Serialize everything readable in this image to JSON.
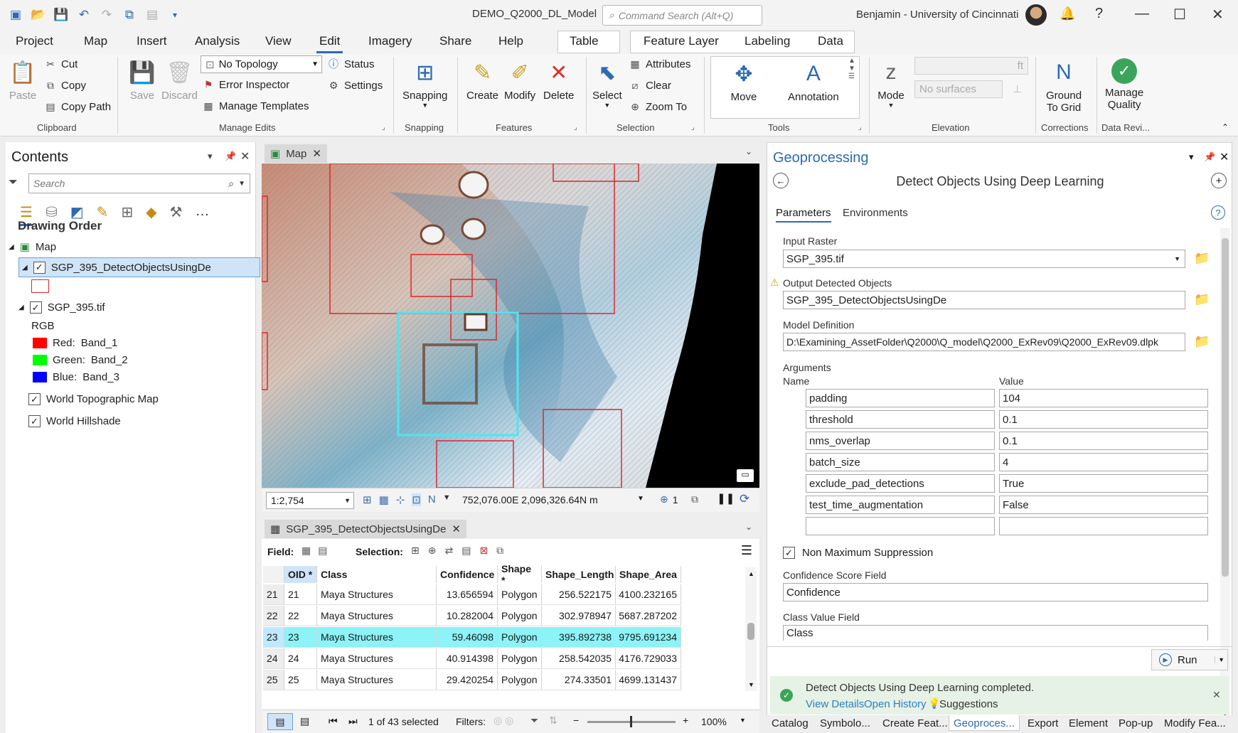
{
  "window": {
    "title": "DEMO_Q2000_DL_Model",
    "command_search_placeholder": "Command Search (Alt+Q)",
    "user": "Benjamin - University of Cincinnati"
  },
  "ribbon_tabs": [
    "Project",
    "Map",
    "Insert",
    "Analysis",
    "View",
    "Edit",
    "Imagery",
    "Share",
    "Help",
    "Table",
    "Feature Layer",
    "Labeling",
    "Data"
  ],
  "active_tab": "Edit",
  "ribbon": {
    "clipboard": {
      "paste": "Paste",
      "cut": "Cut",
      "copy": "Copy",
      "copy_path": "Copy Path",
      "label": "Clipboard"
    },
    "manage_edits": {
      "save": "Save",
      "discard": "Discard",
      "topology": "No Topology",
      "status": "Status",
      "error_inspector": "Error Inspector",
      "settings": "Settings",
      "manage_templates": "Manage Templates",
      "label": "Manage Edits"
    },
    "snapping": {
      "button": "Snapping",
      "label": "Snapping"
    },
    "features": {
      "create": "Create",
      "modify": "Modify",
      "delete": "Delete",
      "label": "Features"
    },
    "selection": {
      "select": "Select",
      "attributes": "Attributes",
      "clear": "Clear",
      "zoom_to": "Zoom To",
      "label": "Selection"
    },
    "tools": {
      "move": "Move",
      "annotation": "Annotation",
      "label": "Tools"
    },
    "elevation": {
      "mode": "Mode",
      "surfaces_placeholder": "No surfaces",
      "unit": "ft",
      "label": "Elevation"
    },
    "corrections": {
      "ground_to_grid_line1": "Ground",
      "ground_to_grid_line2": "To Grid",
      "label": "Corrections"
    },
    "data_review": {
      "manage_quality_line1": "Manage",
      "manage_quality_line2": "Quality",
      "label": "Data Revi..."
    }
  },
  "contents": {
    "title": "Contents",
    "search_placeholder": "Search",
    "drawing_order": "Drawing Order",
    "map": "Map",
    "layer1": "SGP_395_DetectObjectsUsingDe",
    "layer2": "SGP_395.tif",
    "rgb": "RGB",
    "bands": [
      {
        "label": "Red:",
        "band": "Band_1",
        "color": "#ff0000"
      },
      {
        "label": "Green:",
        "band": "Band_2",
        "color": "#00ff00"
      },
      {
        "label": "Blue:",
        "band": "Band_3",
        "color": "#0000ff"
      }
    ],
    "basemap1": "World Topographic Map",
    "basemap2": "World Hillshade"
  },
  "map_view": {
    "tab": "Map",
    "scale": "1:2,754",
    "coordinates": "752,076.00E 2,096,326.64N m",
    "selected_count": "1"
  },
  "attribute_table": {
    "tab": "SGP_395_DetectObjectsUsingDe",
    "field_label": "Field:",
    "selection_label": "Selection:",
    "columns": [
      "OID *",
      "Class",
      "Confidence",
      "Shape *",
      "Shape_Length",
      "Shape_Area"
    ],
    "rows": [
      {
        "rn": "21",
        "oid": "21",
        "class": "Maya Structures",
        "confidence": "13.656594",
        "shape": "Polygon",
        "length": "256.522175",
        "area": "4100.232165"
      },
      {
        "rn": "22",
        "oid": "22",
        "class": "Maya Structures",
        "confidence": "10.282004",
        "shape": "Polygon",
        "length": "302.978947",
        "area": "5687.287202"
      },
      {
        "rn": "23",
        "oid": "23",
        "class": "Maya Structures",
        "confidence": "59.46098",
        "shape": "Polygon",
        "length": "395.892738",
        "area": "9795.691234"
      },
      {
        "rn": "24",
        "oid": "24",
        "class": "Maya Structures",
        "confidence": "40.914398",
        "shape": "Polygon",
        "length": "258.542035",
        "area": "4176.729033"
      },
      {
        "rn": "25",
        "oid": "25",
        "class": "Maya Structures",
        "confidence": "29.420254",
        "shape": "Polygon",
        "length": "274.33501",
        "area": "4699.131437"
      }
    ],
    "selected_row": "23",
    "status": "1 of 43 selected",
    "filters_label": "Filters:",
    "zoom": "100%"
  },
  "geoprocessing": {
    "title": "Geoprocessing",
    "tool": "Detect Objects Using Deep Learning",
    "tab_parameters": "Parameters",
    "tab_environments": "Environments",
    "input_raster_label": "Input Raster",
    "input_raster": "SGP_395.tif",
    "output_label": "Output Detected Objects",
    "output": "SGP_395_DetectObjectsUsingDe",
    "model_label": "Model Definition",
    "model": "D:\\Examining_AssetFolder\\Q2000\\Q_model\\Q2000_ExRev09\\Q2000_ExRev09.dlpk",
    "arguments_label": "Arguments",
    "name_col": "Name",
    "value_col": "Value",
    "arguments": [
      {
        "name": "padding",
        "value": "104"
      },
      {
        "name": "threshold",
        "value": "0.1"
      },
      {
        "name": "nms_overlap",
        "value": "0.1"
      },
      {
        "name": "batch_size",
        "value": "4"
      },
      {
        "name": "exclude_pad_detections",
        "value": "True"
      },
      {
        "name": "test_time_augmentation",
        "value": "False"
      }
    ],
    "nms_label": "Non Maximum Suppression",
    "conf_field_label": "Confidence Score Field",
    "conf_field": "Confidence",
    "class_field_label": "Class Value Field",
    "class_field": "Class",
    "run": "Run",
    "completed": "Detect Objects Using Deep Learning completed.",
    "view_details": "View Details",
    "open_history": "Open History",
    "suggestions": "Suggestions"
  },
  "bottom_tabs": [
    "Catalog",
    "Symbolo...",
    "Create Feat...",
    "Geoproces...",
    "Export",
    "Element",
    "Pop-up",
    "Modify Fea..."
  ],
  "colors": {
    "accent": "#2d6ab3",
    "selection": "#8cf3f7",
    "success_bg": "#e6f2e6"
  }
}
